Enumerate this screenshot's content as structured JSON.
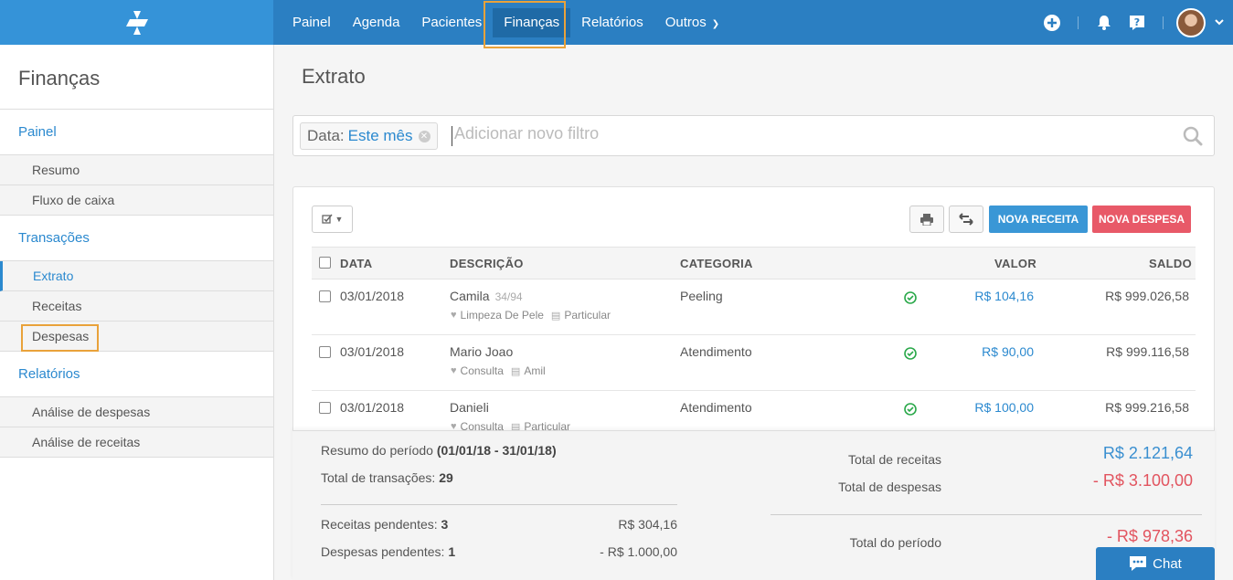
{
  "topnav": {
    "items": [
      {
        "label": "Painel"
      },
      {
        "label": "Agenda"
      },
      {
        "label": "Pacientes"
      },
      {
        "label": "Finanças"
      },
      {
        "label": "Relatórios"
      },
      {
        "label": "Outros"
      }
    ],
    "active": "Finanças"
  },
  "sidebar": {
    "title": "Finanças",
    "sections": [
      {
        "label": "Painel",
        "items": [
          {
            "label": "Resumo"
          },
          {
            "label": "Fluxo de caixa"
          }
        ]
      },
      {
        "label": "Transações",
        "items": [
          {
            "label": "Extrato"
          },
          {
            "label": "Receitas"
          },
          {
            "label": "Despesas"
          }
        ]
      },
      {
        "label": "Relatórios",
        "items": [
          {
            "label": "Análise de despesas"
          },
          {
            "label": "Análise de receitas"
          }
        ]
      }
    ]
  },
  "main": {
    "title": "Extrato",
    "filter": {
      "chip_label": "Data:",
      "chip_value": "Este mês",
      "placeholder": "Adicionar novo filtro"
    },
    "buttons": {
      "nova_receita": "NOVA RECEITA",
      "nova_despesa": "NOVA DESPESA"
    },
    "table": {
      "headers": {
        "data": "DATA",
        "descricao": "DESCRIÇÃO",
        "categoria": "CATEGORIA",
        "valor": "VALOR",
        "saldo": "SALDO"
      },
      "rows": [
        {
          "date": "03/01/2018",
          "name": "Camila",
          "count": "34/94",
          "service": "Limpeza De Pele",
          "payment": "Particular",
          "category": "Peeling",
          "value": "R$ 104,16",
          "balance": "R$ 999.026,58"
        },
        {
          "date": "03/01/2018",
          "name": "Mario Joao",
          "count": "",
          "service": "Consulta",
          "payment": "Amil",
          "category": "Atendimento",
          "value": "R$ 90,00",
          "balance": "R$ 999.116,58"
        },
        {
          "date": "03/01/2018",
          "name": "Danieli",
          "count": "",
          "service": "Consulta",
          "payment": "Particular",
          "category": "Atendimento",
          "value": "R$ 100,00",
          "balance": "R$ 999.216,58"
        }
      ]
    }
  },
  "summary": {
    "period_label": "Resumo do período",
    "period_value": "(01/01/18 - 31/01/18)",
    "transactions_label": "Total de transações:",
    "transactions_value": "29",
    "receitas_pend_label": "Receitas pendentes:",
    "receitas_pend_count": "3",
    "receitas_pend_value": "R$ 304,16",
    "despesas_pend_label": "Despesas pendentes:",
    "despesas_pend_count": "1",
    "despesas_pend_value": "- R$ 1.000,00",
    "total_receitas_label": "Total de receitas",
    "total_receitas_value": "R$ 2.121,64",
    "total_despesas_label": "Total de despesas",
    "total_despesas_value": "- R$ 3.100,00",
    "total_periodo_label": "Total do período",
    "total_periodo_value": "- R$ 978,36"
  },
  "chat": {
    "label": "Chat"
  },
  "colors": {
    "primary": "#2b7fc2",
    "accent_blue": "#2b89cf",
    "danger": "#e85968",
    "highlight": "#e9a23a",
    "success": "#2aa84a"
  }
}
